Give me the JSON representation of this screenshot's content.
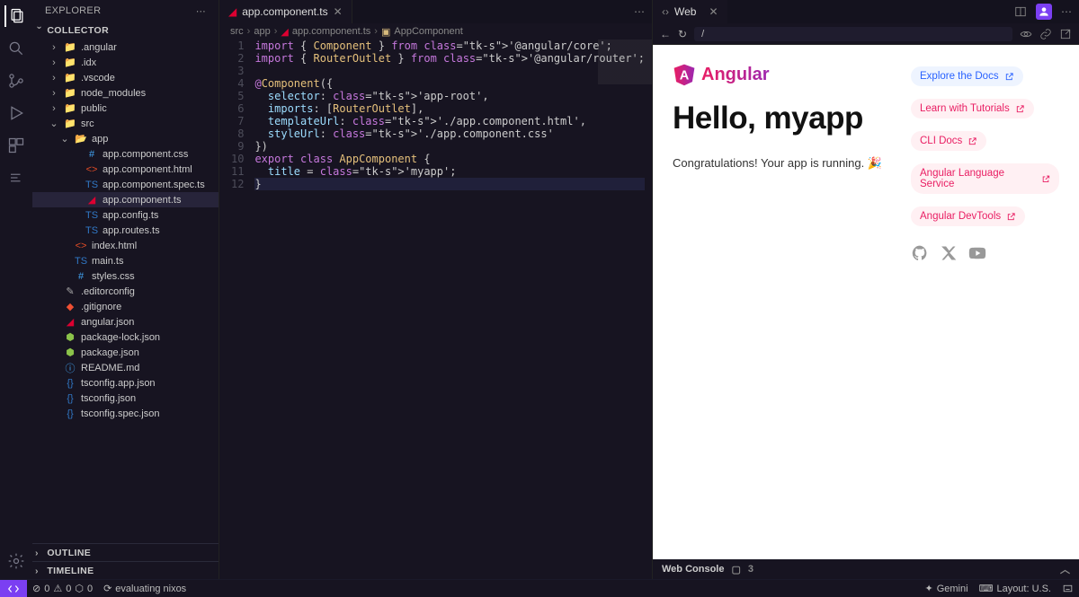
{
  "sidebar": {
    "title": "EXPLORER",
    "project": "COLLECTOR",
    "outline": "OUTLINE",
    "timeline": "TIMELINE",
    "tree": [
      {
        "d": 1,
        "t": "f",
        "open": false,
        "n": ".angular",
        "ic": "fold"
      },
      {
        "d": 1,
        "t": "f",
        "open": false,
        "n": ".idx",
        "ic": "fold"
      },
      {
        "d": 1,
        "t": "f",
        "open": false,
        "n": ".vscode",
        "ic": "fold"
      },
      {
        "d": 1,
        "t": "f",
        "open": false,
        "n": "node_modules",
        "ic": "fold"
      },
      {
        "d": 1,
        "t": "f",
        "open": false,
        "n": "public",
        "ic": "fold"
      },
      {
        "d": 1,
        "t": "f",
        "open": true,
        "n": "src",
        "ic": "fold-g"
      },
      {
        "d": 2,
        "t": "f",
        "open": true,
        "n": "app",
        "ic": "fold-o"
      },
      {
        "d": 3,
        "t": "i",
        "n": "app.component.css",
        "ic": "css"
      },
      {
        "d": 3,
        "t": "i",
        "n": "app.component.html",
        "ic": "html"
      },
      {
        "d": 3,
        "t": "i",
        "n": "app.component.spec.ts",
        "ic": "ts"
      },
      {
        "d": 3,
        "t": "i",
        "n": "app.component.ts",
        "ic": "ang",
        "sel": true
      },
      {
        "d": 3,
        "t": "i",
        "n": "app.config.ts",
        "ic": "ts"
      },
      {
        "d": 3,
        "t": "i",
        "n": "app.routes.ts",
        "ic": "ts"
      },
      {
        "d": 2,
        "t": "i",
        "n": "index.html",
        "ic": "html"
      },
      {
        "d": 2,
        "t": "i",
        "n": "main.ts",
        "ic": "ts"
      },
      {
        "d": 2,
        "t": "i",
        "n": "styles.css",
        "ic": "css"
      },
      {
        "d": 1,
        "t": "i",
        "n": ".editorconfig",
        "ic": "cfg"
      },
      {
        "d": 1,
        "t": "i",
        "n": ".gitignore",
        "ic": "git"
      },
      {
        "d": 1,
        "t": "i",
        "n": "angular.json",
        "ic": "ang"
      },
      {
        "d": 1,
        "t": "i",
        "n": "package-lock.json",
        "ic": "npm"
      },
      {
        "d": 1,
        "t": "i",
        "n": "package.json",
        "ic": "npm"
      },
      {
        "d": 1,
        "t": "i",
        "n": "README.md",
        "ic": "info"
      },
      {
        "d": 1,
        "t": "i",
        "n": "tsconfig.app.json",
        "ic": "tsj"
      },
      {
        "d": 1,
        "t": "i",
        "n": "tsconfig.json",
        "ic": "tsj"
      },
      {
        "d": 1,
        "t": "i",
        "n": "tsconfig.spec.json",
        "ic": "tsj"
      }
    ]
  },
  "editor": {
    "tab_label": "app.component.ts",
    "crumbs": [
      "src",
      "app",
      "app.component.ts",
      "AppComponent"
    ],
    "lines": [
      "import { Component } from '@angular/core';",
      "import { RouterOutlet } from '@angular/router';",
      "",
      "@Component({",
      "  selector: 'app-root',",
      "  imports: [RouterOutlet],",
      "  templateUrl: './app.component.html',",
      "  styleUrl: './app.component.css'",
      "})",
      "export class AppComponent {",
      "  title = 'myapp';",
      "}"
    ]
  },
  "preview": {
    "tab_label": "Web",
    "url": "/",
    "logo": "Angular",
    "heading": "Hello, myapp",
    "subtext": "Congratulations! Your app is running. 🎉",
    "links": [
      {
        "label": "Explore the Docs",
        "cls": "blue"
      },
      {
        "label": "Learn with Tutorials",
        "cls": "pink"
      },
      {
        "label": "CLI Docs",
        "cls": "pink"
      },
      {
        "label": "Angular Language Service",
        "cls": "pink"
      },
      {
        "label": "Angular DevTools",
        "cls": "pink"
      }
    ],
    "console_label": "Web Console",
    "console_count": "3"
  },
  "status": {
    "errors": "0",
    "warnings": "0",
    "ports": "0",
    "task": "evaluating nixos",
    "gemini": "Gemini",
    "layout": "Layout: U.S."
  }
}
